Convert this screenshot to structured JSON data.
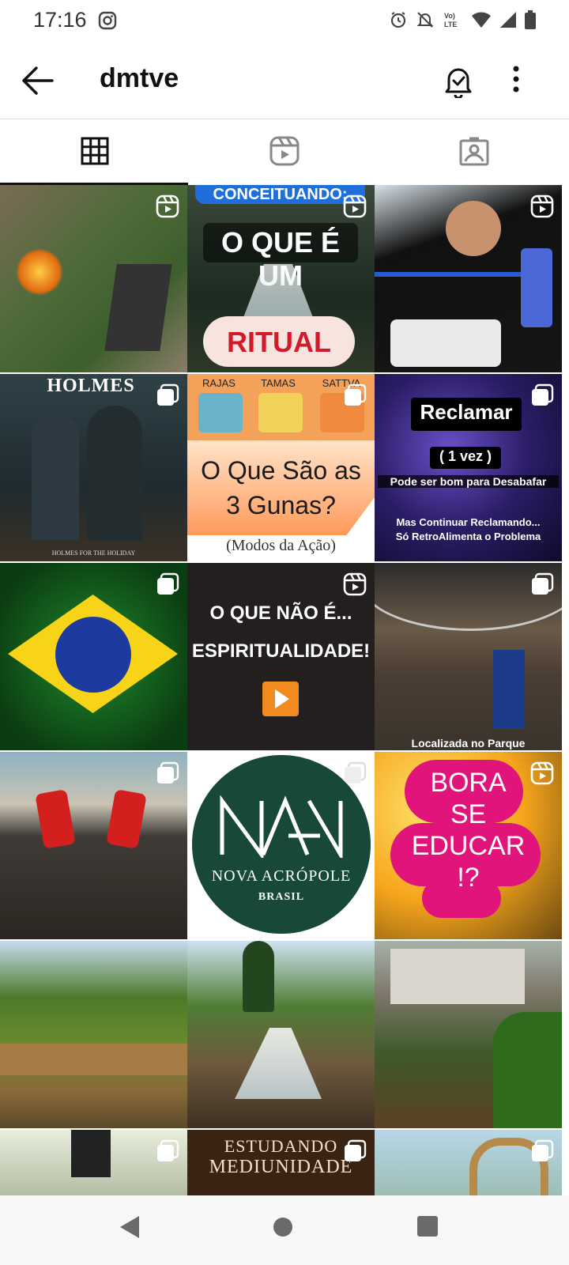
{
  "status_bar": {
    "time": "17:16",
    "network_label": "Vo) LTE"
  },
  "header": {
    "username": "dmtve"
  },
  "tabs": [
    {
      "name": "posts",
      "icon": "grid-icon",
      "active": true
    },
    {
      "name": "reels",
      "icon": "reels-icon",
      "active": false
    },
    {
      "name": "tagged",
      "icon": "tagged-person-icon",
      "active": false
    }
  ],
  "posts": [
    {
      "type": "reel",
      "description": "campfire outdoor scene",
      "text": ""
    },
    {
      "type": "reel",
      "banner": "CONCEITUANDO:",
      "headline": "O QUE É UM",
      "button_text": "RITUAL"
    },
    {
      "type": "reel",
      "description": "two men with phone",
      "text": ""
    },
    {
      "type": "carousel",
      "title": "HOLMES",
      "caption": "HOLMES FOR THE HOLIDAY"
    },
    {
      "type": "carousel",
      "labels": [
        "RAJAS",
        "TAMAS",
        "SATTVA"
      ],
      "headline_1": "O Que São as",
      "headline_2": "3 Gunas?",
      "caption": "(Modos da Ação)"
    },
    {
      "type": "carousel",
      "title": "Reclamar",
      "subtitle": "( 1 vez )",
      "line1": "Pode ser bom para Desabafar",
      "line2": "Mas Continuar Reclamando...",
      "line3": "Só RetroAlimenta o Problema"
    },
    {
      "type": "carousel",
      "description": "Brazil flag",
      "text": ""
    },
    {
      "type": "reel",
      "line1": "O QUE NÃO É...",
      "line2": "ESPIRITUALIDADE!"
    },
    {
      "type": "carousel",
      "caption": "Localizada no Parque"
    },
    {
      "type": "carousel",
      "description": "martial arts on beach",
      "text": ""
    },
    {
      "type": "carousel",
      "brand": "NOVA ACRÓPOLE",
      "country": "BRASIL"
    },
    {
      "type": "reel",
      "lines": [
        "BORA",
        "SE",
        "EDUCAR",
        "!?"
      ]
    },
    {
      "type": "post",
      "description": "rocky landscape",
      "text": ""
    },
    {
      "type": "post",
      "description": "waterfall",
      "text": ""
    },
    {
      "type": "post",
      "description": "building with garden",
      "text": ""
    },
    {
      "type": "carousel",
      "description": "dark cross",
      "text": ""
    },
    {
      "type": "carousel",
      "line1": "ESTUDANDO",
      "line2": "MEDIUNIDADE"
    },
    {
      "type": "carousel",
      "description": "painted gate",
      "text": ""
    }
  ],
  "colors": {
    "accent": "#111111",
    "magenta": "#e0147a",
    "nova_green": "#17483a"
  }
}
